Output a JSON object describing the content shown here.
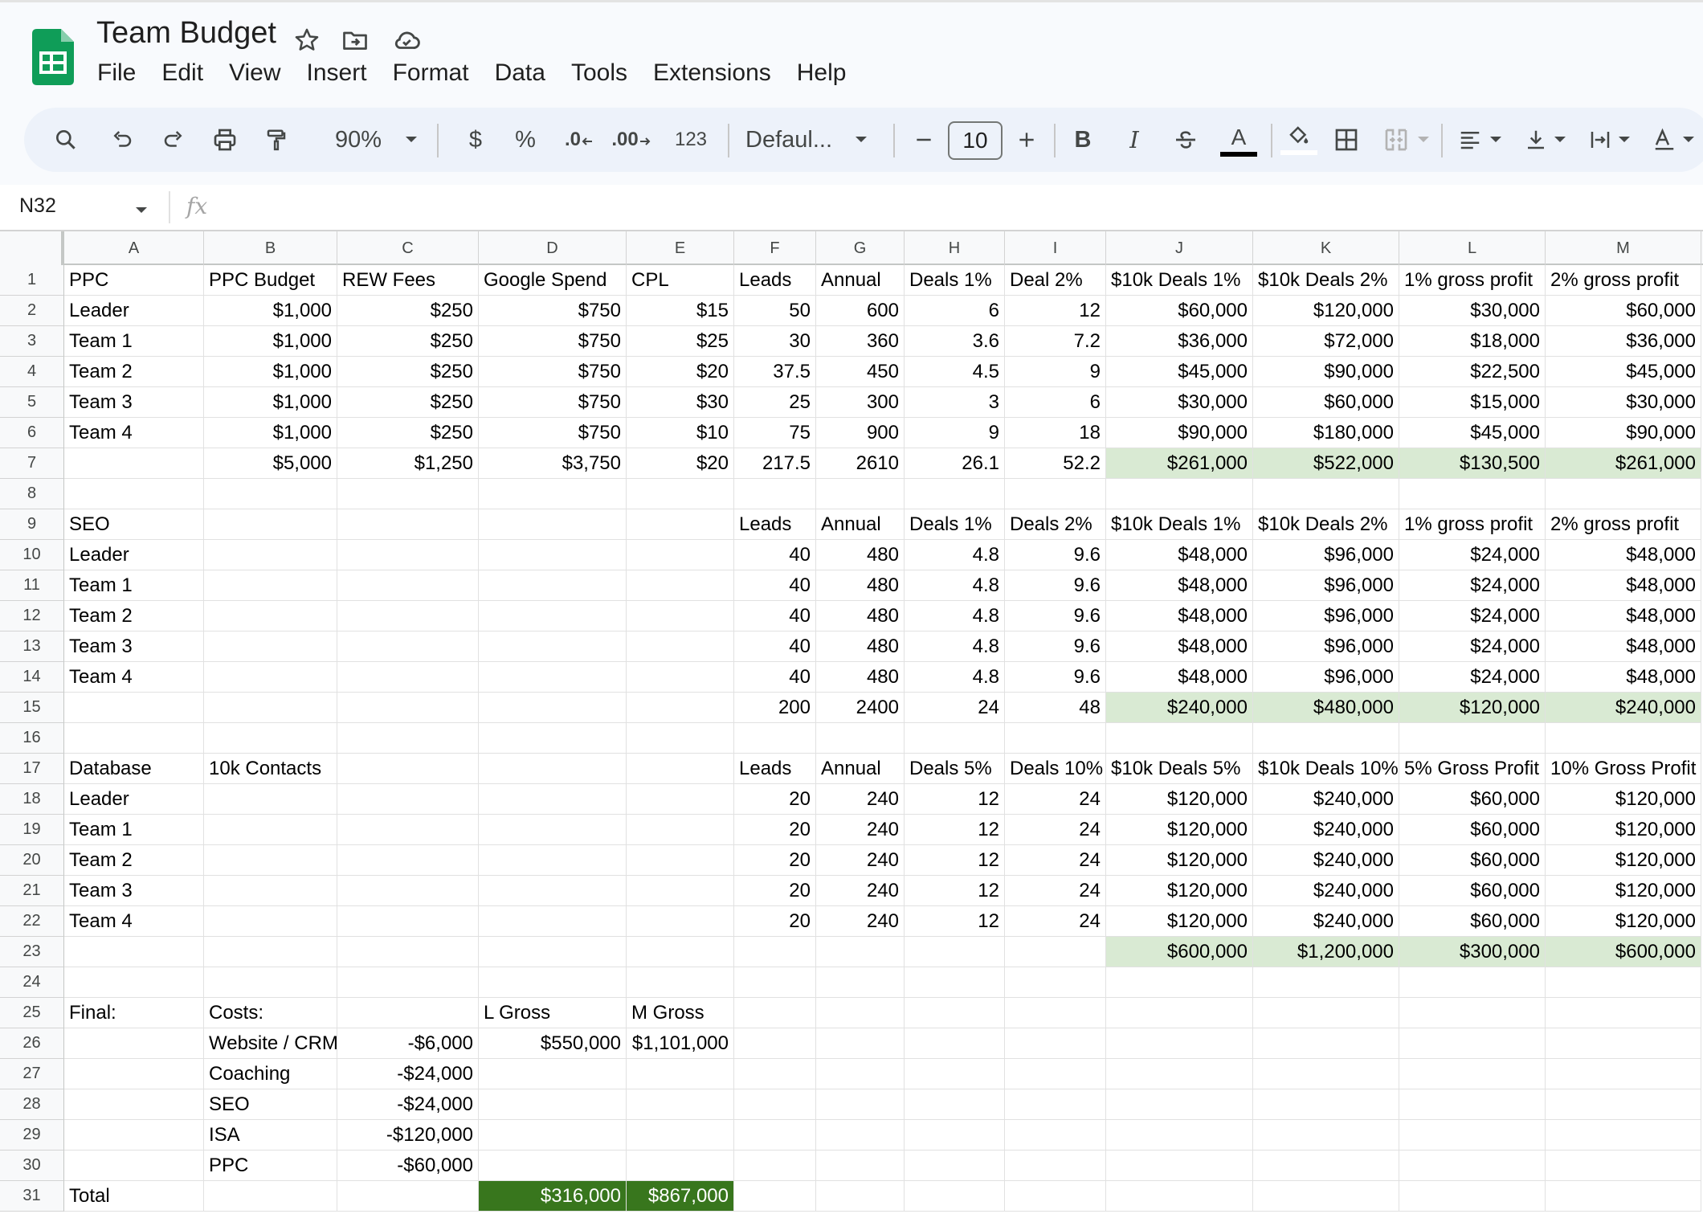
{
  "app": {
    "title": "Team Budget",
    "menu": [
      "File",
      "Edit",
      "View",
      "Insert",
      "Format",
      "Data",
      "Tools",
      "Extensions",
      "Help"
    ]
  },
  "toolbar": {
    "zoom": "90%",
    "currency": "$",
    "percent": "%",
    "decrease_decimal": ".0",
    "increase_decimal": ".00",
    "number_format": "123",
    "font": "Defaul...",
    "font_size": "10",
    "bold": "B",
    "italic": "I",
    "text_color_letter": "A"
  },
  "formula_bar": {
    "cell_ref": "N32",
    "fx": "fx",
    "content": ""
  },
  "columns": [
    "A",
    "B",
    "C",
    "D",
    "E",
    "F",
    "G",
    "H",
    "I",
    "J",
    "K",
    "L",
    "M"
  ],
  "rows": [
    {
      "n": "1",
      "cells": [
        "PPC",
        "PPC Budget",
        "REW Fees",
        "Google Spend",
        "CPL",
        "Leads",
        "Annual",
        "Deals 1%",
        "Deal 2%",
        "$10k Deals 1%",
        "$10k Deals 2%",
        "1% gross profit",
        "2% gross profit"
      ]
    },
    {
      "n": "2",
      "cells": [
        "Leader",
        "$1,000",
        "$250",
        "$750",
        "$15",
        "50",
        "600",
        "6",
        "12",
        "$60,000",
        "$120,000",
        "$30,000",
        "$60,000"
      ]
    },
    {
      "n": "3",
      "cells": [
        "Team 1",
        "$1,000",
        "$250",
        "$750",
        "$25",
        "30",
        "360",
        "3.6",
        "7.2",
        "$36,000",
        "$72,000",
        "$18,000",
        "$36,000"
      ]
    },
    {
      "n": "4",
      "cells": [
        "Team 2",
        "$1,000",
        "$250",
        "$750",
        "$20",
        "37.5",
        "450",
        "4.5",
        "9",
        "$45,000",
        "$90,000",
        "$22,500",
        "$45,000"
      ]
    },
    {
      "n": "5",
      "cells": [
        "Team 3",
        "$1,000",
        "$250",
        "$750",
        "$30",
        "25",
        "300",
        "3",
        "6",
        "$30,000",
        "$60,000",
        "$15,000",
        "$30,000"
      ]
    },
    {
      "n": "6",
      "cells": [
        "Team 4",
        "$1,000",
        "$250",
        "$750",
        "$10",
        "75",
        "900",
        "9",
        "18",
        "$90,000",
        "$180,000",
        "$45,000",
        "$90,000"
      ]
    },
    {
      "n": "7",
      "cells": [
        "",
        "$5,000",
        "$1,250",
        "$3,750",
        "$20",
        "217.5",
        "2610",
        "26.1",
        "52.2",
        "$261,000",
        "$522,000",
        "$130,500",
        "$261,000"
      ]
    },
    {
      "n": "8",
      "cells": [
        "",
        "",
        "",
        "",
        "",
        "",
        "",
        "",
        "",
        "",
        "",
        "",
        ""
      ]
    },
    {
      "n": "9",
      "cells": [
        "SEO",
        "",
        "",
        "",
        "",
        "Leads",
        "Annual",
        "Deals 1%",
        "Deals 2%",
        "$10k Deals 1%",
        "$10k Deals 2%",
        "1% gross profit",
        "2% gross profit"
      ]
    },
    {
      "n": "10",
      "cells": [
        "Leader",
        "",
        "",
        "",
        "",
        "40",
        "480",
        "4.8",
        "9.6",
        "$48,000",
        "$96,000",
        "$24,000",
        "$48,000"
      ]
    },
    {
      "n": "11",
      "cells": [
        "Team 1",
        "",
        "",
        "",
        "",
        "40",
        "480",
        "4.8",
        "9.6",
        "$48,000",
        "$96,000",
        "$24,000",
        "$48,000"
      ]
    },
    {
      "n": "12",
      "cells": [
        "Team 2",
        "",
        "",
        "",
        "",
        "40",
        "480",
        "4.8",
        "9.6",
        "$48,000",
        "$96,000",
        "$24,000",
        "$48,000"
      ]
    },
    {
      "n": "13",
      "cells": [
        "Team 3",
        "",
        "",
        "",
        "",
        "40",
        "480",
        "4.8",
        "9.6",
        "$48,000",
        "$96,000",
        "$24,000",
        "$48,000"
      ]
    },
    {
      "n": "14",
      "cells": [
        "Team 4",
        "",
        "",
        "",
        "",
        "40",
        "480",
        "4.8",
        "9.6",
        "$48,000",
        "$96,000",
        "$24,000",
        "$48,000"
      ]
    },
    {
      "n": "15",
      "cells": [
        "",
        "",
        "",
        "",
        "",
        "200",
        "2400",
        "24",
        "48",
        "$240,000",
        "$480,000",
        "$120,000",
        "$240,000"
      ]
    },
    {
      "n": "16",
      "cells": [
        "",
        "",
        "",
        "",
        "",
        "",
        "",
        "",
        "",
        "",
        "",
        "",
        ""
      ]
    },
    {
      "n": "17",
      "cells": [
        "Database",
        "10k Contacts",
        "",
        "",
        "",
        "Leads",
        "Annual",
        "Deals 5%",
        "Deals 10%",
        "$10k Deals 5%",
        "$10k Deals 10%",
        "5% Gross Profit",
        "10% Gross Profit"
      ]
    },
    {
      "n": "18",
      "cells": [
        "Leader",
        "",
        "",
        "",
        "",
        "20",
        "240",
        "12",
        "24",
        "$120,000",
        "$240,000",
        "$60,000",
        "$120,000"
      ]
    },
    {
      "n": "19",
      "cells": [
        "Team 1",
        "",
        "",
        "",
        "",
        "20",
        "240",
        "12",
        "24",
        "$120,000",
        "$240,000",
        "$60,000",
        "$120,000"
      ]
    },
    {
      "n": "20",
      "cells": [
        "Team 2",
        "",
        "",
        "",
        "",
        "20",
        "240",
        "12",
        "24",
        "$120,000",
        "$240,000",
        "$60,000",
        "$120,000"
      ]
    },
    {
      "n": "21",
      "cells": [
        "Team 3",
        "",
        "",
        "",
        "",
        "20",
        "240",
        "12",
        "24",
        "$120,000",
        "$240,000",
        "$60,000",
        "$120,000"
      ]
    },
    {
      "n": "22",
      "cells": [
        "Team 4",
        "",
        "",
        "",
        "",
        "20",
        "240",
        "12",
        "24",
        "$120,000",
        "$240,000",
        "$60,000",
        "$120,000"
      ]
    },
    {
      "n": "23",
      "cells": [
        "",
        "",
        "",
        "",
        "",
        "",
        "",
        "",
        "",
        "$600,000",
        "$1,200,000",
        "$300,000",
        "$600,000"
      ]
    },
    {
      "n": "24",
      "cells": [
        "",
        "",
        "",
        "",
        "",
        "",
        "",
        "",
        "",
        "",
        "",
        "",
        ""
      ]
    },
    {
      "n": "25",
      "cells": [
        "Final:",
        "Costs:",
        "",
        "L Gross",
        "M Gross",
        "",
        "",
        "",
        "",
        "",
        "",
        "",
        ""
      ]
    },
    {
      "n": "26",
      "cells": [
        "",
        "Website / CRM",
        "-$6,000",
        "$550,000",
        "$1,101,000",
        "",
        "",
        "",
        "",
        "",
        "",
        "",
        ""
      ]
    },
    {
      "n": "27",
      "cells": [
        "",
        "Coaching",
        "-$24,000",
        "",
        "",
        "",
        "",
        "",
        "",
        "",
        "",
        "",
        ""
      ]
    },
    {
      "n": "28",
      "cells": [
        "",
        "SEO",
        "-$24,000",
        "",
        "",
        "",
        "",
        "",
        "",
        "",
        "",
        "",
        ""
      ]
    },
    {
      "n": "29",
      "cells": [
        "",
        "ISA",
        "-$120,000",
        "",
        "",
        "",
        "",
        "",
        "",
        "",
        "",
        "",
        ""
      ]
    },
    {
      "n": "30",
      "cells": [
        "",
        "PPC",
        "-$60,000",
        "",
        "",
        "",
        "",
        "",
        "",
        "",
        "",
        "",
        ""
      ]
    },
    {
      "n": "31",
      "cells": [
        "Total",
        "",
        "",
        "$316,000",
        "$867,000",
        "",
        "",
        "",
        "",
        "",
        "",
        "",
        ""
      ]
    }
  ],
  "colors": {
    "total_highlight": "#d9ead3",
    "final_total_highlight": "#38761d",
    "sheets_logo": "#0f9d58"
  }
}
